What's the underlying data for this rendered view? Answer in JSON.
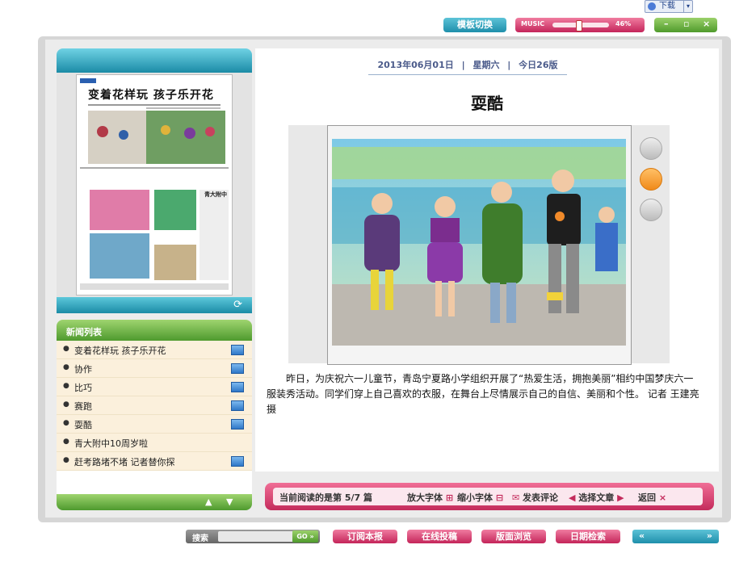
{
  "top_chip": {
    "label": "下载",
    "arrow": "▾"
  },
  "toolbar": {
    "template_switch": "模板切换",
    "music_label": "MUSIC",
    "music_volume_percent": 46,
    "music_volume_text": "46%",
    "minimize": "–",
    "restore": "▫",
    "close": "×"
  },
  "left_panel": {
    "thumb_headline": "变着花样玩  孩子乐开花",
    "list_title": "新闻列表",
    "items": [
      {
        "label": "变着花样玩  孩子乐开花",
        "has_photo": true
      },
      {
        "label": "协作",
        "has_photo": true
      },
      {
        "label": "比巧",
        "has_photo": true
      },
      {
        "label": "赛跑",
        "has_photo": true
      },
      {
        "label": "耍酷",
        "has_photo": true
      },
      {
        "label": "青大附中10周岁啦",
        "has_photo": false
      },
      {
        "label": "赶考路堵不堵  记者替你探",
        "has_photo": true
      }
    ]
  },
  "article": {
    "date": "2013年06月01日",
    "weekday": "星期六",
    "edition": "今日26版",
    "title": "耍酷",
    "body": "　　昨日，为庆祝六一儿童节，青岛宁夏路小学组织开展了“热爱生活，拥抱美丽”相约中国梦庆六一服装秀活动。同学们穿上自己喜欢的衣服，在舞台上尽情展示自己的自信、美丽和个性。  记者  王建亮  摄"
  },
  "status": {
    "reading": "当前阅读的是第  5/7  篇",
    "zoom_in": "放大字体",
    "zoom_out": "缩小字体",
    "comment": "发表评论",
    "select_article": "选择文章",
    "back": "返回"
  },
  "bottom": {
    "search_label": "搜索",
    "search_go": "GO",
    "subscribe": "订阅本报",
    "submit": "在线投稿",
    "browse": "版面浏览",
    "date_search": "日期检索",
    "prev": "«",
    "next": "»"
  },
  "colors": {
    "teal": "#1f8fab",
    "pink": "#c4255a",
    "green": "#4f9a2c",
    "cream": "#fbf0dc"
  }
}
